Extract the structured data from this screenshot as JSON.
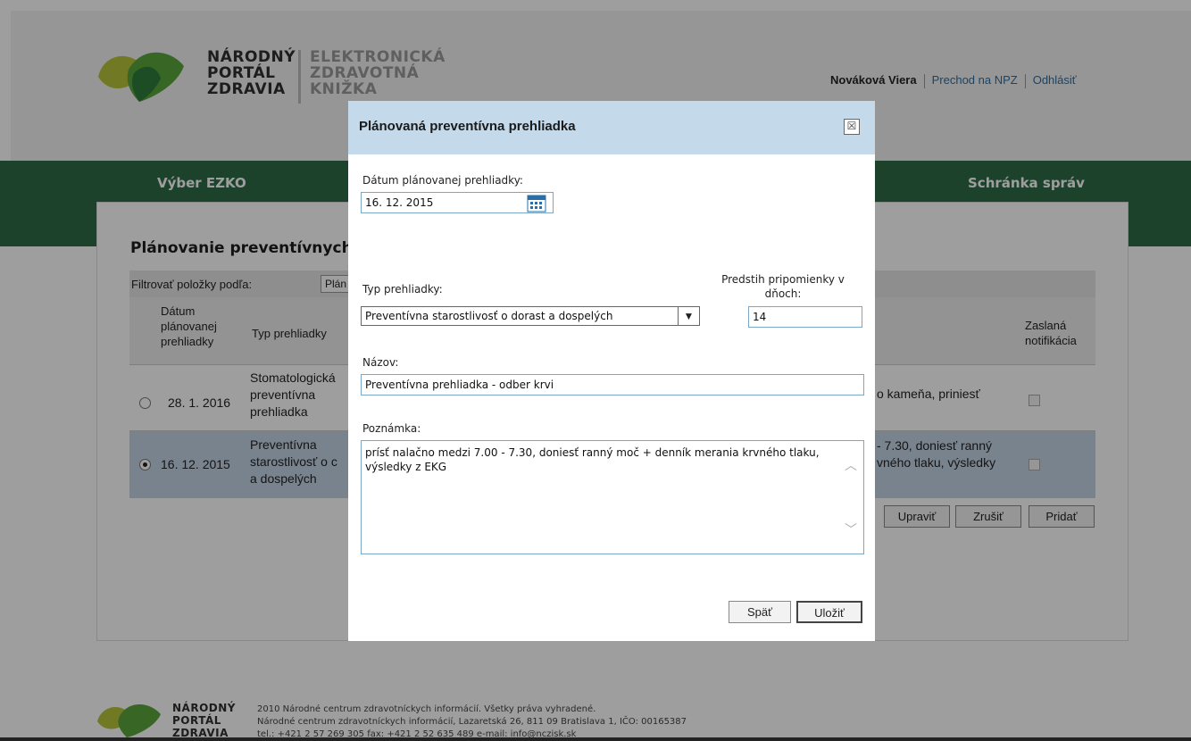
{
  "header": {
    "logo_line1": "NÁRODNÝ",
    "logo_line2": "PORTÁL",
    "logo_line3": "ZDRAVIA",
    "sublogo_line1": "ELEKTRONICKÁ",
    "sublogo_line2": "ZDRAVOTNÁ",
    "sublogo_line3": "KNIŽKA",
    "user_name": "Nováková Viera",
    "link_npz": "Prechod na NPZ",
    "link_logout": "Odhlásiť"
  },
  "nav": {
    "left": "Výber EZKO",
    "right": "Schránka správ"
  },
  "main": {
    "title": "Plánovanie preventívnych",
    "filter_label": "Filtrovať položky podľa:",
    "filter_value": "Plán",
    "columns": {
      "date_l1": "Dátum",
      "date_l2": "plánovanej",
      "date_l3": "prehliadky",
      "type": "Typ prehliadky",
      "notif_l1": "Zaslaná",
      "notif_l2": "notifikácia"
    },
    "rows": [
      {
        "date": "28. 1. 2016",
        "type_l1": "Stomatologická",
        "type_l2": "preventívna",
        "type_l3": "prehliadka",
        "note": "o kameňa, priniesť"
      },
      {
        "date": "16. 12. 2015",
        "type_l1": "Preventívna",
        "type_l2": "starostlivosť o c",
        "type_l3": "a dospelých",
        "note_l1": "- 7.30, doniesť ranný",
        "note_l2": "vného tlaku, výsledky"
      }
    ],
    "buttons": {
      "edit": "Upraviť",
      "cancel": "Zrušiť",
      "add": "Pridať"
    }
  },
  "dialog": {
    "title": "Plánovaná preventívna prehliadka",
    "close_symbol": "☒",
    "date_label": "Dátum plánovanej prehliadky:",
    "date_value": "16. 12. 2015",
    "type_label": "Typ prehliadky:",
    "type_value": "Preventívna starostlivosť o dorast a dospelých",
    "advance_label_l1": "Predstih pripomienky v",
    "advance_label_l2": "dňoch:",
    "advance_value": "14",
    "name_label": "Názov:",
    "name_value": "Preventívna prehliadka - odber krvi",
    "note_label": "Poznámka:",
    "note_value": "prísť nalačno medzi 7.00 - 7.30, doniesť ranný moč + denník merania krvného tlaku, výsledky z EKG",
    "back_button": "Späť",
    "save_button": "Uložiť"
  },
  "footer": {
    "logo_line1": "NÁRODNÝ",
    "logo_line2": "PORTÁL",
    "logo_line3": "ZDRAVIA",
    "line1": "2010 Národné centrum zdravotníckych informácií. Všetky práva vyhradené.",
    "line2": "Národné centrum zdravotníckych informácií, Lazaretská 26, 811 09 Bratislava 1, IČO: 00165387",
    "line3": "tel.: +421 2 57 269 305  fax: +421 2 52 635 489  e-mail: info@nczisk.sk"
  },
  "colors": {
    "green_bar": "#2e6b47",
    "dialog_header": "#c4d9ea",
    "selected_row": "#c3d3e5",
    "link": "#2a6fa7"
  }
}
